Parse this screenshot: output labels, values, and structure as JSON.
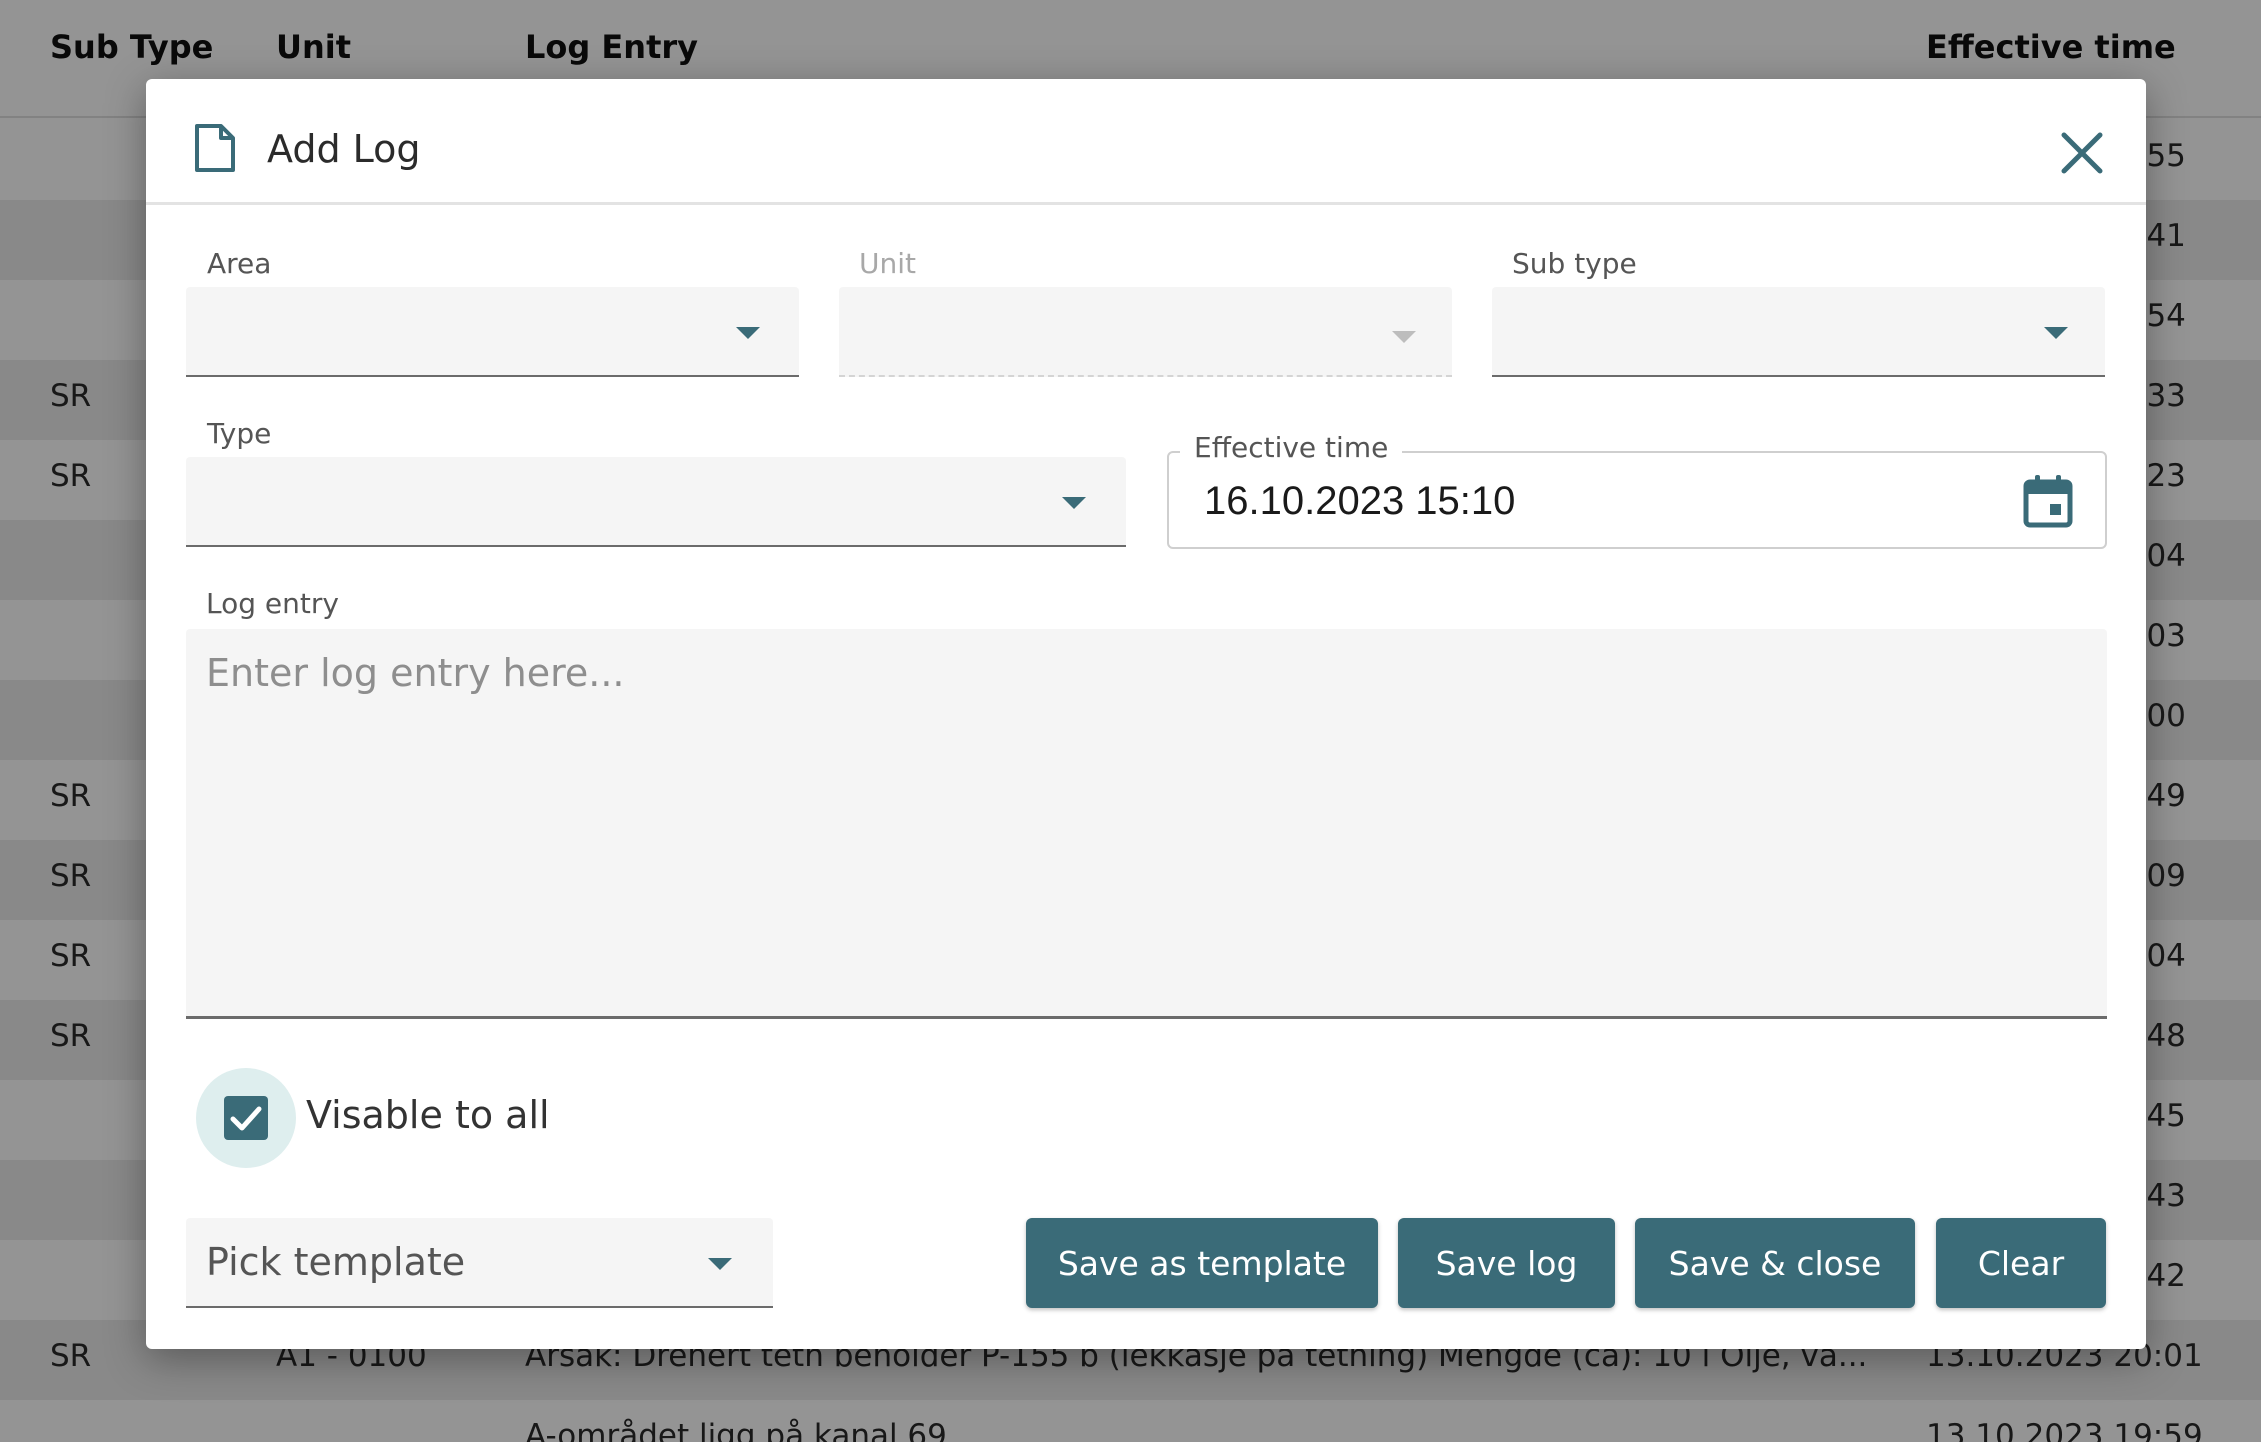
{
  "background_table": {
    "headers": {
      "sub_type": "Sub Type",
      "unit": "Unit",
      "log_entry": "Log Entry",
      "effective_time": "Effective time"
    },
    "rows": [
      {
        "sub_type": "",
        "unit": "",
        "log_entry": "",
        "time": ":55"
      },
      {
        "sub_type": "",
        "unit": "",
        "log_entry": "",
        "time": ":41"
      },
      {
        "sub_type": "",
        "unit": "",
        "log_entry": "",
        "time": ":54"
      },
      {
        "sub_type": "SR",
        "unit": "",
        "log_entry": "",
        "time": ":33"
      },
      {
        "sub_type": "SR",
        "unit": "",
        "log_entry": "",
        "time": ":23"
      },
      {
        "sub_type": "",
        "unit": "",
        "log_entry": "",
        "time": ":04"
      },
      {
        "sub_type": "",
        "unit": "",
        "log_entry": "",
        "time": ":03"
      },
      {
        "sub_type": "",
        "unit": "",
        "log_entry": "",
        "time": ":00"
      },
      {
        "sub_type": "SR",
        "unit": "",
        "log_entry": "",
        "time": ":49"
      },
      {
        "sub_type": "SR",
        "unit": "",
        "log_entry": "",
        "time": ":09"
      },
      {
        "sub_type": "SR",
        "unit": "",
        "log_entry": "",
        "time": ":04"
      },
      {
        "sub_type": "SR",
        "unit": "",
        "log_entry": "",
        "time": ":48"
      },
      {
        "sub_type": "",
        "unit": "",
        "log_entry": "",
        "time": ":45"
      },
      {
        "sub_type": "",
        "unit": "",
        "log_entry": "",
        "time": ":43"
      },
      {
        "sub_type": "",
        "unit": "",
        "log_entry": "",
        "time": ":42"
      },
      {
        "sub_type": "SR",
        "unit": "A1 - 0100",
        "log_entry": "Arsak: Drenert tetn beholder P-155 b (lekkasje på tetning) Mengde (ca): 10 l Olje, va...",
        "time": "13.10.2023 20:01"
      },
      {
        "sub_type": "",
        "unit": "",
        "log_entry": "A-området ligg på kanal 69",
        "time": "13.10.2023 19:59"
      }
    ]
  },
  "dialog": {
    "title": "Add Log",
    "title_icon": "document-icon",
    "close_icon": "close-icon",
    "fields": {
      "area": {
        "label": "Area",
        "value": ""
      },
      "unit": {
        "label": "Unit",
        "value": "",
        "disabled": true
      },
      "sub_type": {
        "label": "Sub type",
        "value": ""
      },
      "type": {
        "label": "Type",
        "value": ""
      },
      "effective_time": {
        "label": "Effective time",
        "value": "16.10.2023 15:10"
      },
      "log_entry": {
        "label": "Log entry",
        "placeholder": "Enter log entry here...",
        "value": ""
      }
    },
    "visible_to_all": {
      "label": "Visable to all",
      "checked": true
    },
    "template": {
      "placeholder": "Pick template"
    },
    "buttons": {
      "save_as_template": "Save as template",
      "save_log": "Save log",
      "save_close": "Save & close",
      "clear": "Clear"
    }
  },
  "colors": {
    "accent": "#3a6b78",
    "accent_light": "#deeeee",
    "overlay": "rgba(0,0,0,0.42)"
  }
}
